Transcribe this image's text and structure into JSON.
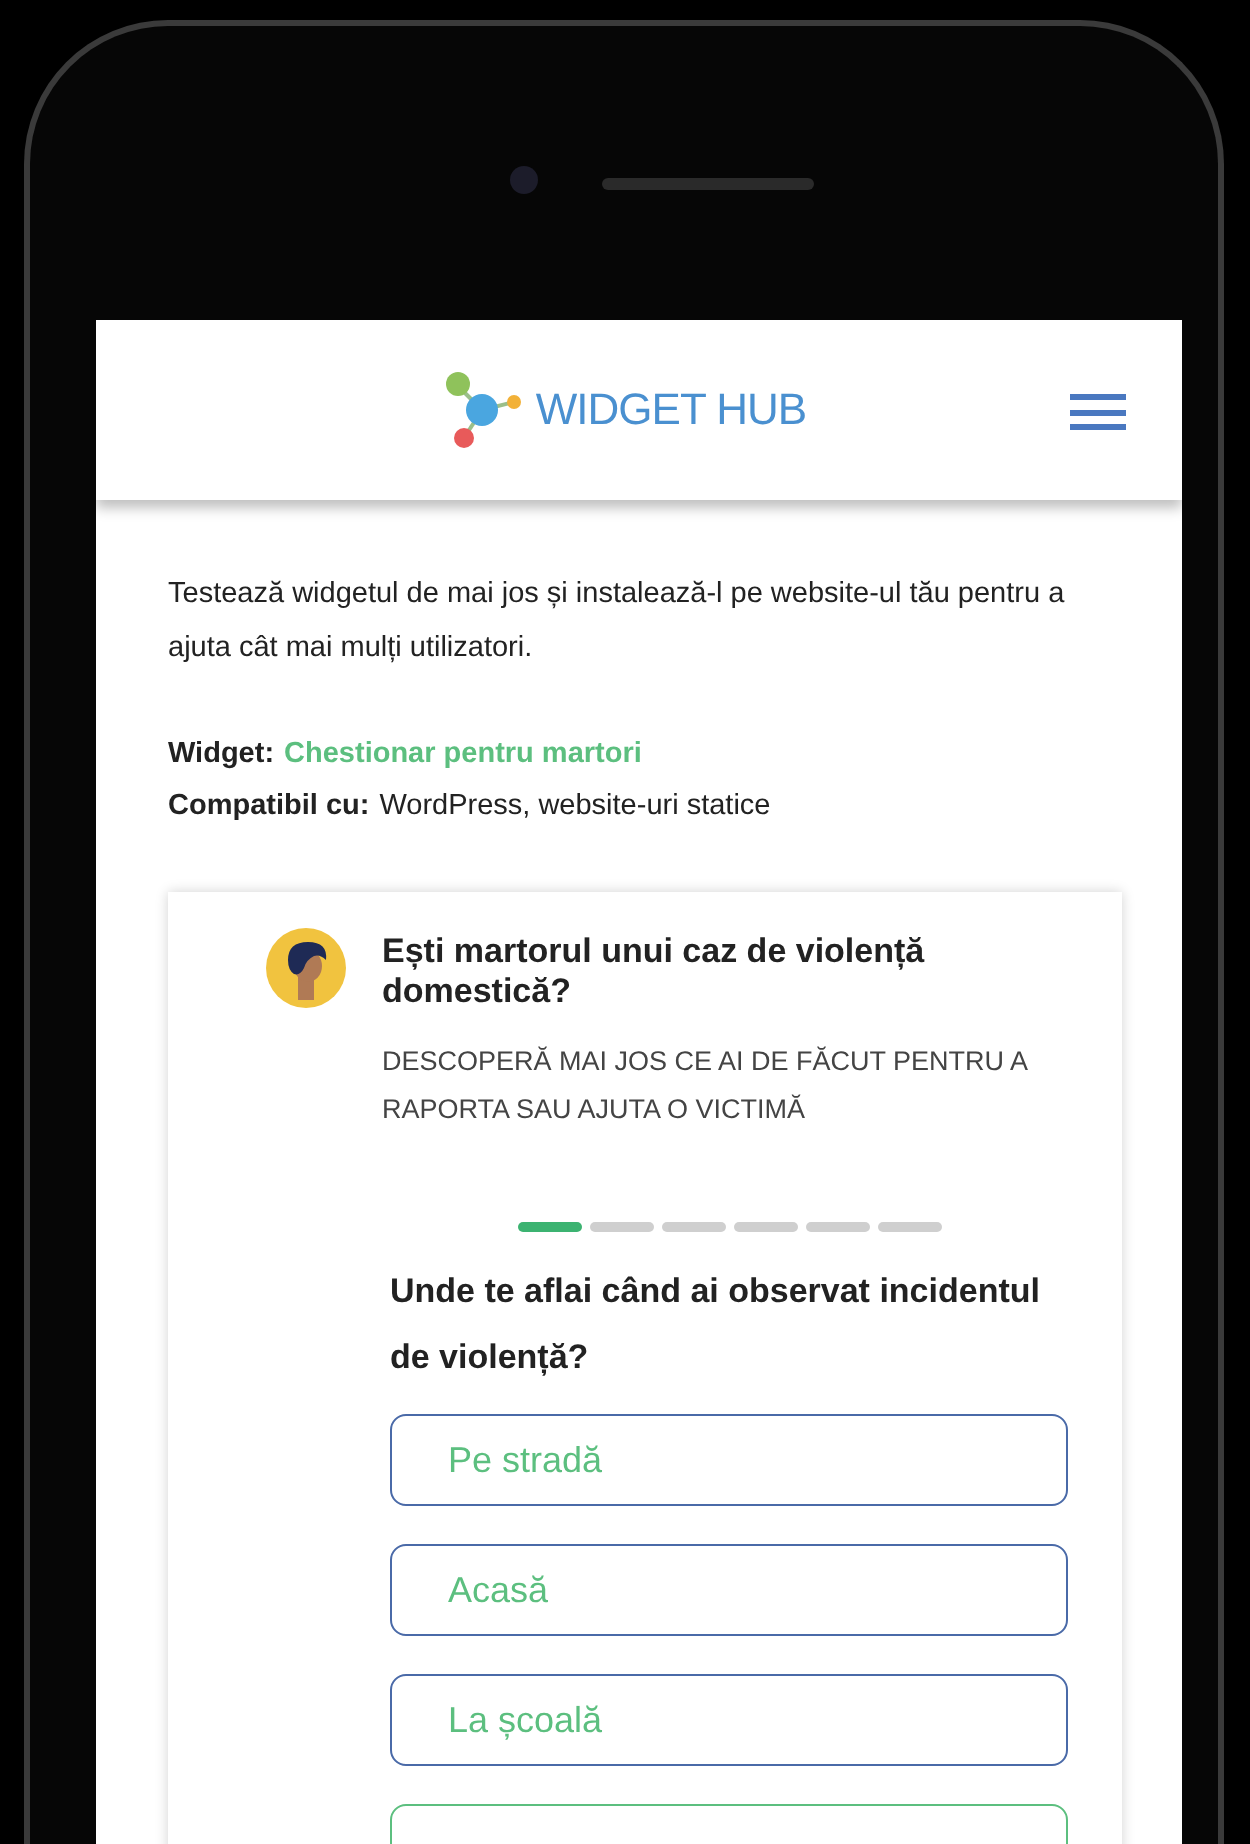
{
  "header": {
    "logo_text": "WIDGET HUB"
  },
  "intro": {
    "description": "Testează widgetul de mai jos și instalează-l pe website-ul tău pentru a ajuta cât mai mulți utilizatori.",
    "widget_label": "Widget:",
    "widget_name": "Chestionar pentru martori",
    "compat_label": "Compatibil cu:",
    "compat_value": "WordPress, website-uri statice"
  },
  "quiz": {
    "title": "Ești martorul unui caz de violență domestică?",
    "subtitle": "DESCOPERĂ MAI JOS CE AI DE FĂCUT PENTRU A RAPORTA SAU AJUTA O VICTIMĂ",
    "progress_steps": [
      {
        "done": true
      },
      {
        "done": false
      },
      {
        "done": false
      },
      {
        "done": false
      },
      {
        "done": false
      },
      {
        "done": false
      }
    ],
    "question": "Unde te aflai când ai observat incidentul de violență?",
    "options": [
      {
        "label": "Pe stradă",
        "selected": false
      },
      {
        "label": "Acasă",
        "selected": false
      },
      {
        "label": "La școală",
        "selected": false
      },
      {
        "selected": true
      }
    ]
  }
}
